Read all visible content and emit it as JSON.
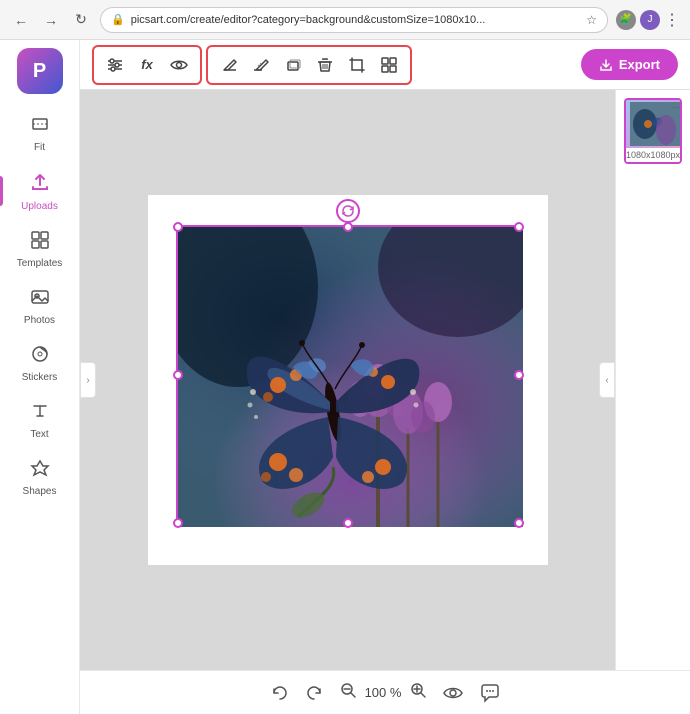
{
  "browser": {
    "back_btn": "←",
    "forward_btn": "→",
    "refresh_btn": "↻",
    "url": "picsart.com/create/editor?category=background&customSize=1080x10...",
    "star_icon": "★",
    "puzzle_icon": "🧩",
    "profile_initial": "J",
    "more_btn": "⋮"
  },
  "sidebar": {
    "logo_text": "P",
    "items": [
      {
        "id": "fit",
        "label": "Fit",
        "icon": "⊡"
      },
      {
        "id": "uploads",
        "label": "Uploads",
        "icon": "↑",
        "active": true
      },
      {
        "id": "templates",
        "label": "Templates",
        "icon": "⊞"
      },
      {
        "id": "photos",
        "label": "Photos",
        "icon": "🖼"
      },
      {
        "id": "stickers",
        "label": "Stickers",
        "icon": "◎"
      },
      {
        "id": "text",
        "label": "Text",
        "icon": "T"
      },
      {
        "id": "shapes",
        "label": "Shapes",
        "icon": "☆"
      }
    ]
  },
  "toolbar": {
    "group1": {
      "adjust_icon": "≡",
      "fx_label": "fx",
      "eye_icon": "👁"
    },
    "group2": {
      "erase_icon": "◇",
      "erase2_icon": "◈",
      "layer_icon": "▭",
      "trash_icon": "🗑",
      "crop_icon": "⌗",
      "grid_icon": "⊞"
    },
    "export_label": "Export",
    "export_icon": "↓"
  },
  "right_panel": {
    "thumbnail_label": "1080x1080px",
    "dots": "···"
  },
  "canvas": {
    "rotation_icon": "↻"
  },
  "bottom_bar": {
    "undo_icon": "←",
    "redo_icon": "→",
    "zoom_out_icon": "⊖",
    "zoom_level": "100 %",
    "zoom_in_icon": "⊕",
    "eye_icon": "👁",
    "chat_icon": "💬"
  }
}
